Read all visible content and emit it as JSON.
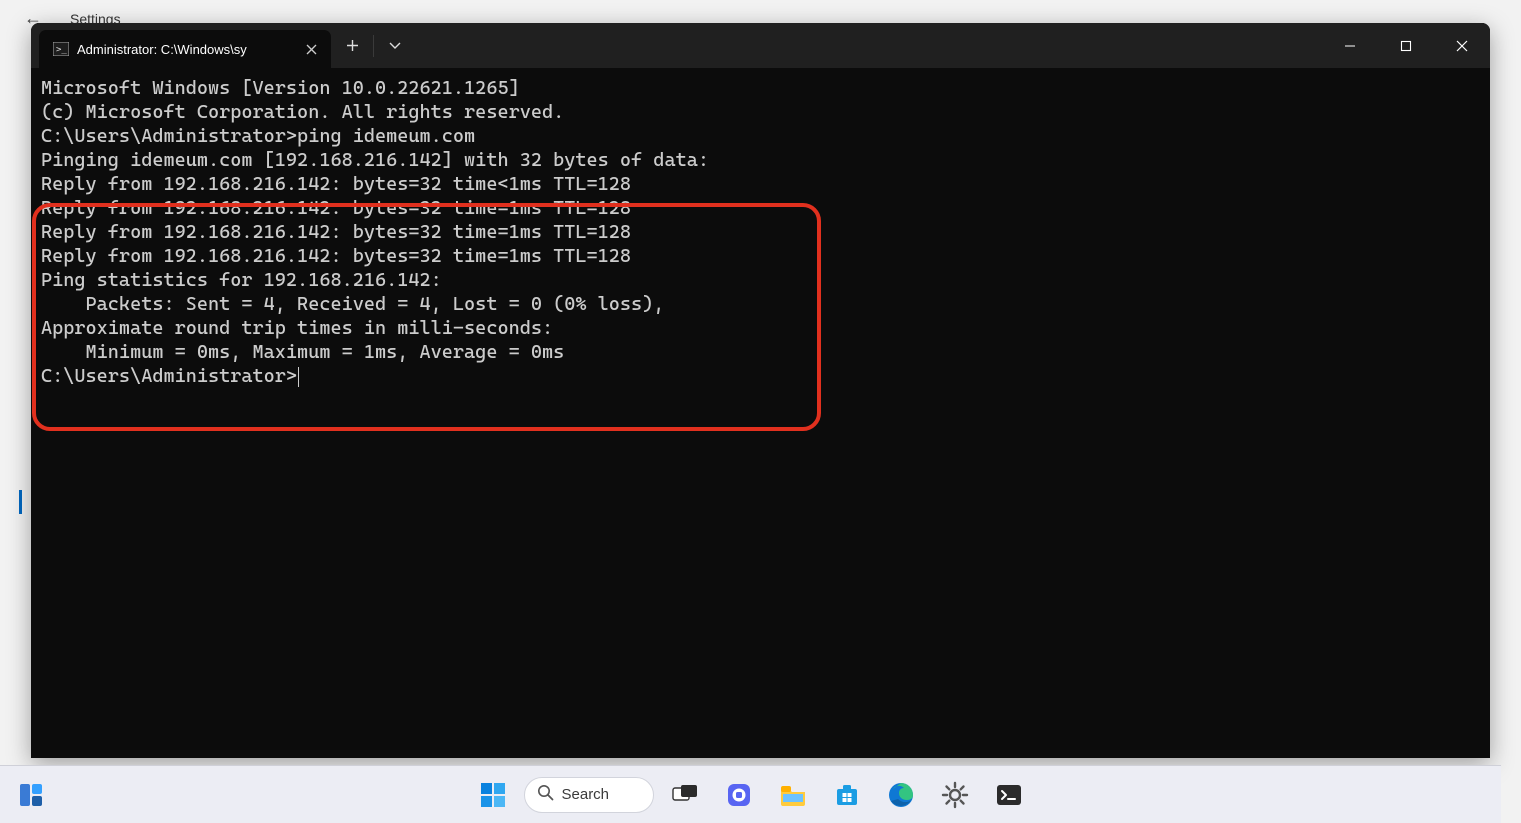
{
  "background_nav": {
    "back_arrow_glyph": "←",
    "title": "Settings"
  },
  "terminal": {
    "tab_title": "Administrator: C:\\Windows\\sy",
    "lines": [
      "Microsoft Windows [Version 10.0.22621.1265]",
      "(c) Microsoft Corporation. All rights reserved.",
      "",
      "C:\\Users\\Administrator>ping idemeum.com",
      "",
      "Pinging idemeum.com [192.168.216.142] with 32 bytes of data:",
      "Reply from 192.168.216.142: bytes=32 time<1ms TTL=128",
      "Reply from 192.168.216.142: bytes=32 time=1ms TTL=128",
      "Reply from 192.168.216.142: bytes=32 time=1ms TTL=128",
      "Reply from 192.168.216.142: bytes=32 time=1ms TTL=128",
      "",
      "Ping statistics for 192.168.216.142:",
      "    Packets: Sent = 4, Received = 4, Lost = 0 (0% loss),",
      "Approximate round trip times in milli-seconds:",
      "    Minimum = 0ms, Maximum = 1ms, Average = 0ms",
      "",
      "C:\\Users\\Administrator>"
    ]
  },
  "taskbar": {
    "search_label": "Search"
  }
}
